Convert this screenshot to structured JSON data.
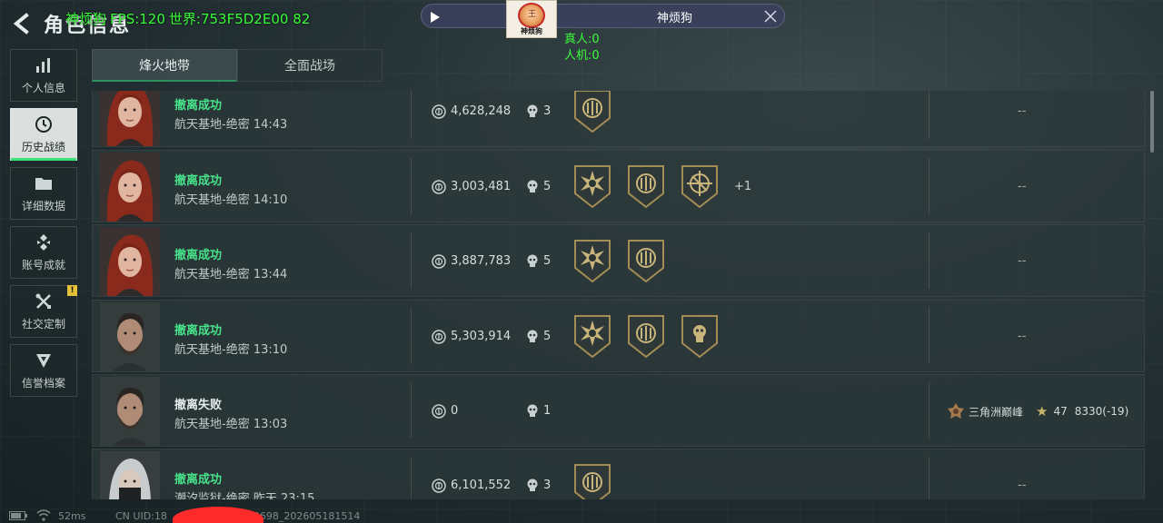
{
  "header": {
    "page_title": "角色信息",
    "debug_name": "神烦狗",
    "debug_fps": "FPS:120",
    "debug_world": "世界:753F5D2E00 82"
  },
  "overlay": {
    "player_name": "神烦狗",
    "avatar_caption": "神烦狗",
    "real_count": "真人:0",
    "bot_count": "人机:0"
  },
  "sidebar": {
    "items": [
      {
        "label": "个人信息",
        "icon": "bar-chart-icon"
      },
      {
        "label": "历史战绩",
        "icon": "clock-icon",
        "active": true
      },
      {
        "label": "详细数据",
        "icon": "folder-icon"
      },
      {
        "label": "账号成就",
        "icon": "achievement-icon"
      },
      {
        "label": "社交定制",
        "icon": "tools-icon",
        "badge": "!"
      },
      {
        "label": "信誉档案",
        "icon": "shield-icon"
      }
    ]
  },
  "tabs": [
    {
      "label": "烽火地带",
      "active": true
    },
    {
      "label": "全面战场",
      "active": false
    }
  ],
  "matches": [
    {
      "result": "撤离成功",
      "status": "success",
      "map": "航天基地-绝密 14:43",
      "value": "4,628,248",
      "kills": "3",
      "medals": [
        "emblem-medal-icon"
      ],
      "extra": "",
      "right": "--",
      "portrait": "red-hair-woman"
    },
    {
      "result": "撤离成功",
      "status": "success",
      "map": "航天基地-绝密 14:10",
      "value": "3,003,481",
      "kills": "5",
      "medals": [
        "star-burst-medal-icon",
        "emblem-medal-icon",
        "crosshair-medal-icon"
      ],
      "extra": "+1",
      "right": "--",
      "portrait": "red-hair-woman"
    },
    {
      "result": "撤离成功",
      "status": "success",
      "map": "航天基地-绝密 13:44",
      "value": "3,887,783",
      "kills": "5",
      "medals": [
        "star-burst-medal-icon",
        "emblem-medal-icon"
      ],
      "extra": "",
      "right": "--",
      "portrait": "red-hair-woman"
    },
    {
      "result": "撤离成功",
      "status": "success",
      "map": "航天基地-绝密 13:10",
      "value": "5,303,914",
      "kills": "5",
      "medals": [
        "star-burst-medal-icon",
        "emblem-medal-icon",
        "skull-medal-icon"
      ],
      "extra": "",
      "right": "--",
      "portrait": "bearded-man"
    },
    {
      "result": "撤离失败",
      "status": "fail",
      "map": "航天基地-绝密 13:03",
      "value": "0",
      "kills": "1",
      "medals": [],
      "extra": "",
      "right": "",
      "rank_name": "三角洲巅峰",
      "rank_stars": "47",
      "rank_score": "8330(-19)",
      "portrait": "bearded-man"
    },
    {
      "result": "撤离成功",
      "status": "success",
      "map": "潮汐监狱-绝密 昨天 23:15",
      "value": "6,101,552",
      "kills": "3",
      "medals": [
        "emblem-medal-icon"
      ],
      "extra": "",
      "right": "--",
      "portrait": "masked-silver-hair"
    }
  ],
  "footer": {
    "ping": "52ms",
    "uid_prefix": "CN UID:18",
    "uid_suffix": "34698_202605181514"
  },
  "colors": {
    "success": "#47e28a",
    "debug": "#39ff3a",
    "redaction": "#ff2a2a"
  }
}
